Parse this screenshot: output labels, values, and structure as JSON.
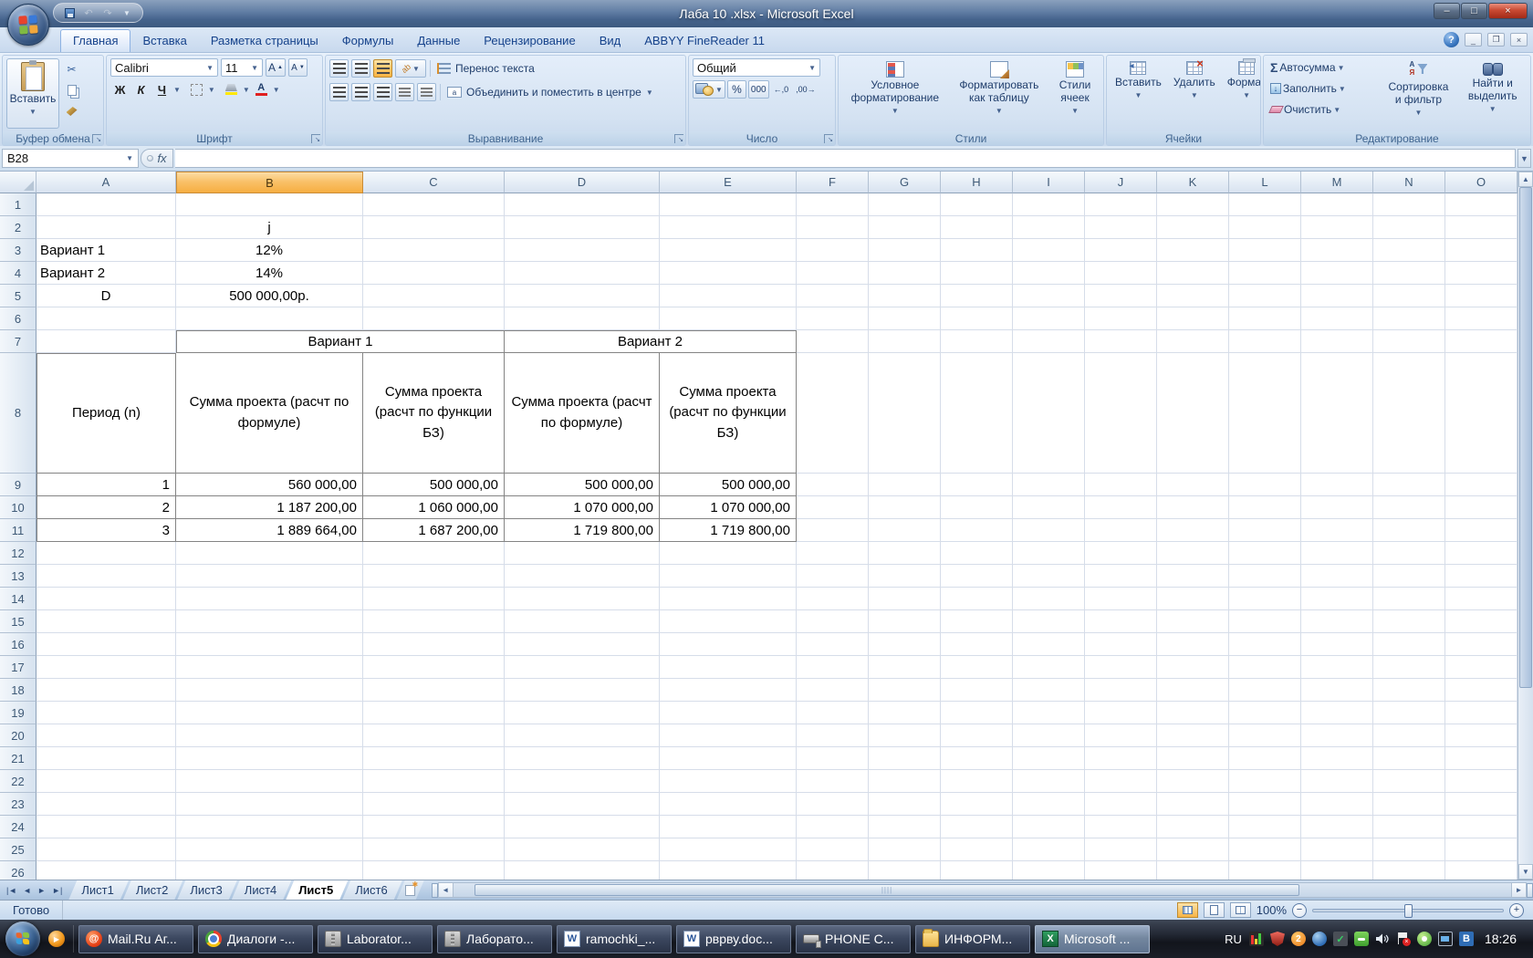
{
  "window": {
    "title": "Лаба 10 .xlsx - Microsoft Excel",
    "help": "?",
    "minimize": "–",
    "maximize": "□",
    "close": "×"
  },
  "colors": {
    "selected_column_header": "#f6ae41",
    "ribbon_text": "#15428b",
    "close_button_red": "#c94a33",
    "excel_green": "#14653a",
    "office_logo": [
      "#e8432d",
      "#3a7ad9",
      "#7fba42",
      "#f2a73d"
    ]
  },
  "ribbon": {
    "tabs": [
      {
        "label": "Главная",
        "active": true
      },
      {
        "label": "Вставка",
        "active": false
      },
      {
        "label": "Разметка страницы",
        "active": false
      },
      {
        "label": "Формулы",
        "active": false
      },
      {
        "label": "Данные",
        "active": false
      },
      {
        "label": "Рецензирование",
        "active": false
      },
      {
        "label": "Вид",
        "active": false
      },
      {
        "label": "ABBYY FineReader 11",
        "active": false
      }
    ],
    "clipboard": {
      "group": "Буфер обмена",
      "paste": "Вставить"
    },
    "font": {
      "group": "Шрифт",
      "family": "Calibri",
      "size": "11",
      "bold": "Ж",
      "italic": "К",
      "underline": "Ч"
    },
    "alignment": {
      "group": "Выравнивание",
      "wrap": "Перенос текста",
      "merge": "Объединить и поместить в центре"
    },
    "number": {
      "group": "Число",
      "format": "Общий",
      "percent": "%",
      "thousands": "000"
    },
    "styles": {
      "group": "Стили",
      "conditional": "Условное\nформатирование",
      "as_table": "Форматировать\nкак таблицу",
      "cell_styles": "Стили\nячеек"
    },
    "cells": {
      "group": "Ячейки",
      "insert": "Вставить",
      "delete": "Удалить",
      "format": "Формат"
    },
    "editing": {
      "group": "Редактирование",
      "autosum": "Автосумма",
      "fill": "Заполнить",
      "clear": "Очистить",
      "sort": "Сортировка\nи фильтр",
      "find": "Найти и\nвыделить"
    }
  },
  "formula_bar": {
    "name_box": "B28",
    "fx": "fx"
  },
  "sheet": {
    "columns": [
      "A",
      "B",
      "C",
      "D",
      "E",
      "F",
      "G",
      "H",
      "I",
      "J",
      "K",
      "L",
      "M",
      "N",
      "O"
    ],
    "selected_column": "B",
    "row_count": 26,
    "merged_row_7": [
      {
        "from": "B",
        "to": "C",
        "t": "Вариант 1"
      },
      {
        "from": "D",
        "to": "E",
        "t": "Вариант 2"
      }
    ],
    "cells": {
      "2": {
        "B": {
          "t": "j",
          "a": "c"
        }
      },
      "3": {
        "A": {
          "t": "Вариант 1",
          "a": "l"
        },
        "B": {
          "t": "12%",
          "a": "c"
        }
      },
      "4": {
        "A": {
          "t": "Вариант 2",
          "a": "l"
        },
        "B": {
          "t": "14%",
          "a": "c"
        }
      },
      "5": {
        "A": {
          "t": "D",
          "a": "c"
        },
        "B": {
          "t": "500 000,00р.",
          "a": "c"
        }
      },
      "8": {
        "A": {
          "t": "Период (n)",
          "a": "c",
          "b": true,
          "w": true
        },
        "B": {
          "t": "Сумма проекта (расчт по формуле)",
          "a": "c",
          "b": true,
          "w": true
        },
        "C": {
          "t": "Сумма проекта (расчт по функции БЗ)",
          "a": "c",
          "b": true,
          "w": true
        },
        "D": {
          "t": "Сумма проекта (расчт по формуле)",
          "a": "c",
          "b": true,
          "w": true
        },
        "E": {
          "t": "Сумма проекта (расчт по функции БЗ)",
          "a": "c",
          "b": true,
          "w": true
        }
      },
      "9": {
        "A": {
          "t": "1",
          "a": "r",
          "b": true
        },
        "B": {
          "t": "560 000,00",
          "a": "r",
          "b": true
        },
        "C": {
          "t": "500 000,00",
          "a": "r",
          "b": true
        },
        "D": {
          "t": "500 000,00",
          "a": "r",
          "b": true
        },
        "E": {
          "t": "500 000,00",
          "a": "r",
          "b": true
        }
      },
      "10": {
        "A": {
          "t": "2",
          "a": "r",
          "b": true
        },
        "B": {
          "t": "1 187 200,00",
          "a": "r",
          "b": true
        },
        "C": {
          "t": "1 060 000,00",
          "a": "r",
          "b": true
        },
        "D": {
          "t": "1 070 000,00",
          "a": "r",
          "b": true
        },
        "E": {
          "t": "1 070 000,00",
          "a": "r",
          "b": true
        }
      },
      "11": {
        "A": {
          "t": "3",
          "a": "r",
          "b": true
        },
        "B": {
          "t": "1 889 664,00",
          "a": "r",
          "b": true
        },
        "C": {
          "t": "1 687 200,00",
          "a": "r",
          "b": true
        },
        "D": {
          "t": "1 719 800,00",
          "a": "r",
          "b": true
        },
        "E": {
          "t": "1 719 800,00",
          "a": "r",
          "b": true
        }
      }
    }
  },
  "sheet_tabs": {
    "tabs": [
      "Лист1",
      "Лист2",
      "Лист3",
      "Лист4",
      "Лист5",
      "Лист6"
    ],
    "active": "Лист5"
  },
  "status_bar": {
    "mode": "Готово",
    "zoom": "100%"
  },
  "taskbar": {
    "language": "RU",
    "clock": "18:26",
    "buttons": [
      {
        "label": "Mail.Ru Аг...",
        "icon": "mailru-icon",
        "active": false
      },
      {
        "label": "Диалоги -...",
        "icon": "chrome-icon",
        "active": false
      },
      {
        "label": "Laborator...",
        "icon": "archive-icon",
        "active": false
      },
      {
        "label": "Лаборато...",
        "icon": "archive-icon",
        "active": false
      },
      {
        "label": "ramochki_...",
        "icon": "word-doc-icon",
        "active": false
      },
      {
        "label": "рврву.doc...",
        "icon": "word-doc-icon",
        "active": false
      },
      {
        "label": "PHONE C...",
        "icon": "usb-drive-icon",
        "active": false
      },
      {
        "label": "ИНФОРМ...",
        "icon": "folder-icon",
        "active": false
      },
      {
        "label": "Microsoft ...",
        "icon": "excel-icon",
        "active": true
      }
    ],
    "tray_icons": [
      "stats-icon",
      "antivirus-shield-icon",
      "qip-icon",
      "updater-icon",
      "agent-check-icon",
      "robot-icon",
      "volume-icon",
      "action-center-flag-icon",
      "green-app-icon",
      "network-display-icon",
      "bluetooth-b-icon"
    ]
  }
}
